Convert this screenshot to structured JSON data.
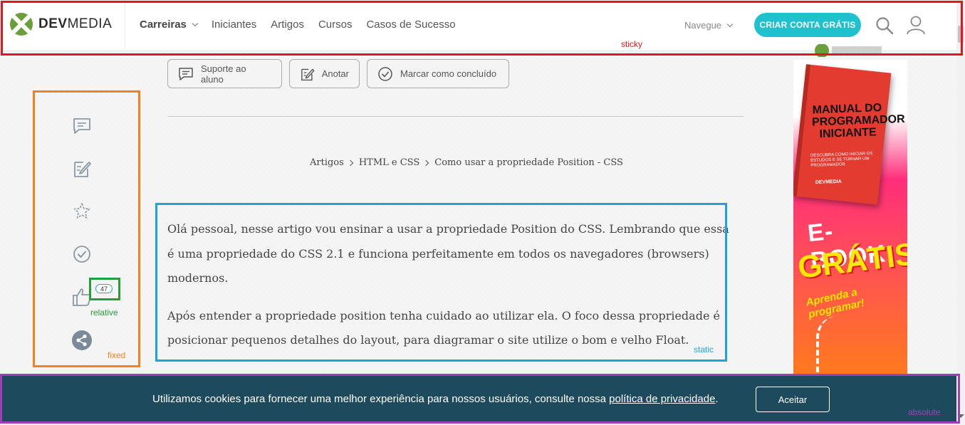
{
  "header": {
    "logo_bold": "DEV",
    "logo_light": "MEDIA",
    "nav": [
      {
        "label": "Carreiras",
        "dropdown": true
      },
      {
        "label": "Iniciantes"
      },
      {
        "label": "Artigos"
      },
      {
        "label": "Cursos"
      },
      {
        "label": "Casos de Sucesso"
      }
    ],
    "navegue": "Navegue",
    "cta": "CRIAR CONTA GRÁTIS",
    "icons": [
      "search-icon",
      "user-icon"
    ]
  },
  "actions": {
    "support": "Suporte ao aluno",
    "note": "Anotar",
    "complete": "Marcar como concluído"
  },
  "breadcrumb": [
    "Artigos",
    "HTML e CSS",
    "Como usar a propriedade Position - CSS"
  ],
  "article": {
    "p1": "Olá pessoal, nesse artigo vou ensinar a usar a propriedade Position do CSS. Lembrando que essa é uma propriedade do CSS 2.1 e funciona perfeitamente em todos os navegadores (browsers) modernos.",
    "p2": "Após entender a propriedade position tenha cuidado ao utilizar ela. O foco dessa propriedade é posicionar pequenos detalhes do layout, para diagramar o site utilize o bom e velho Float."
  },
  "sidebar": {
    "icons": [
      "comment-icon",
      "edit-icon",
      "star-icon",
      "check-circle-icon",
      "thumbs-up-icon",
      "share-icon"
    ],
    "like_count": "47"
  },
  "ad": {
    "book_title": "MANUAL DO PROGRAMADOR INICIANTE",
    "book_subtitle": "DESCUBRA COMO INICIAR OS ESTUDOS E SE TORNAR UM PROGRAMADOR",
    "book_brand": "DEVMEDIA",
    "headline": "E-BOOK",
    "highlight": "GRÁTIS",
    "tagline": "Aprenda a programar!"
  },
  "cookie": {
    "text_before": "Utilizamos cookies para fornecer uma melhor experiência para nossos usuários, consulte nossa ",
    "link": "política de privacidade",
    "text_after": ".",
    "button": "Aceitar"
  },
  "annotations": {
    "sticky": "sticky",
    "fixed": "fixed",
    "relative": "relative",
    "static": "static",
    "absolute": "absolute"
  },
  "colors": {
    "brand_green": "#6a9f3b",
    "cta": "#1fc1cf",
    "cookie_bg": "#1d4b5d",
    "sticky_box": "#e8141c",
    "fixed_box": "#f7801e",
    "relative_box": "#21a038",
    "static_box": "#1fa3e0",
    "absolute_box": "#a040b8"
  }
}
